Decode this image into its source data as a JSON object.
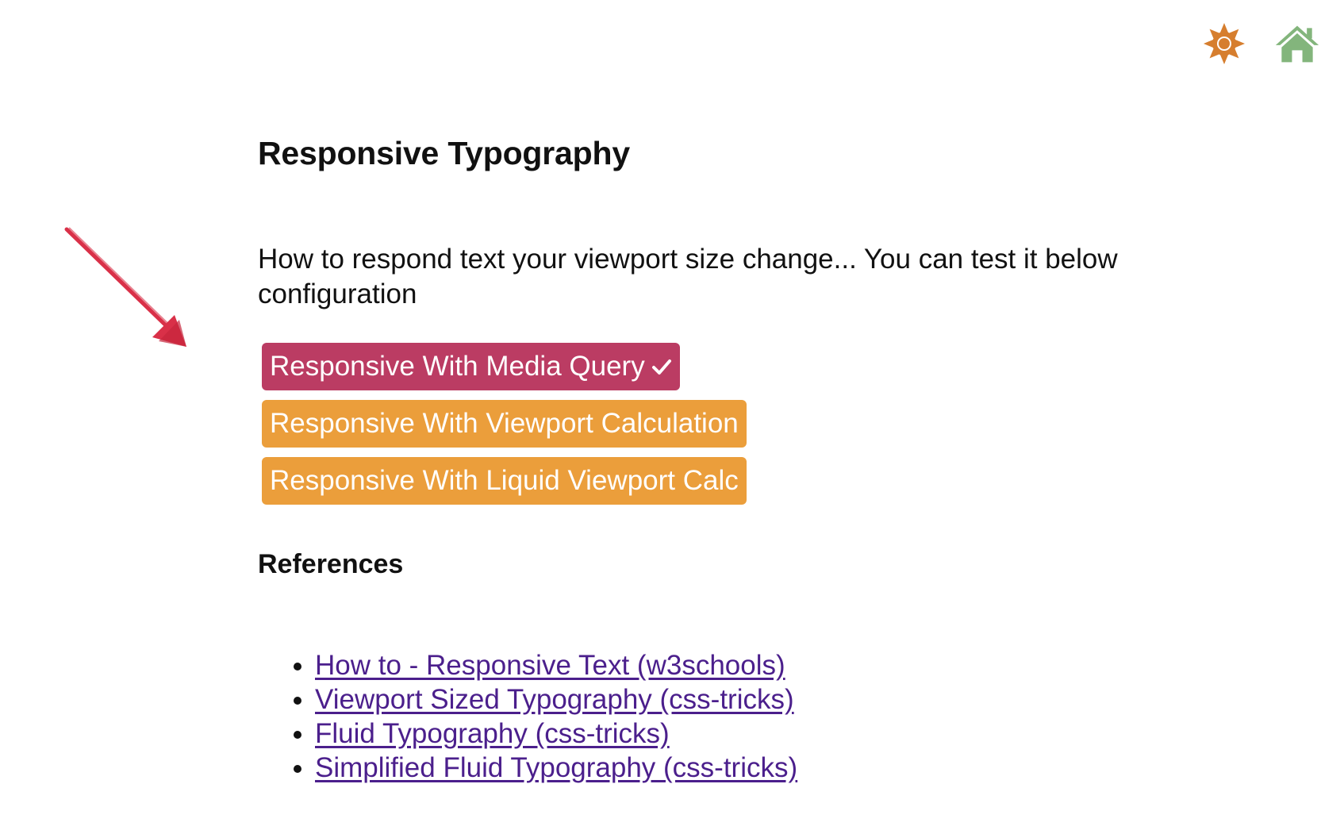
{
  "header": {
    "icons": [
      {
        "name": "sun-icon",
        "color": "#d67e2e"
      },
      {
        "name": "home-icon",
        "color": "#83b57c"
      }
    ]
  },
  "annotation": {
    "color": "#d93048"
  },
  "main": {
    "title": "Responsive Typography",
    "description": "How to respond text your viewport size change... You can test it below configuration",
    "options": [
      {
        "label": "Responsive With Media Query",
        "selected": true,
        "color": "#bb3c63"
      },
      {
        "label": "Responsive With Viewport Calculation",
        "selected": false,
        "color": "#eb9e3b"
      },
      {
        "label": "Responsive With Liquid Viewport Calc",
        "selected": false,
        "color": "#eb9e3b"
      }
    ],
    "references_title": "References",
    "references": [
      "How to - Responsive Text (w3schools)",
      "Viewport Sized Typography (css-tricks)",
      "Fluid Typography (css-tricks)",
      "Simplified Fluid Typography (css-tricks)"
    ],
    "link_color": "#4b1f8c"
  }
}
